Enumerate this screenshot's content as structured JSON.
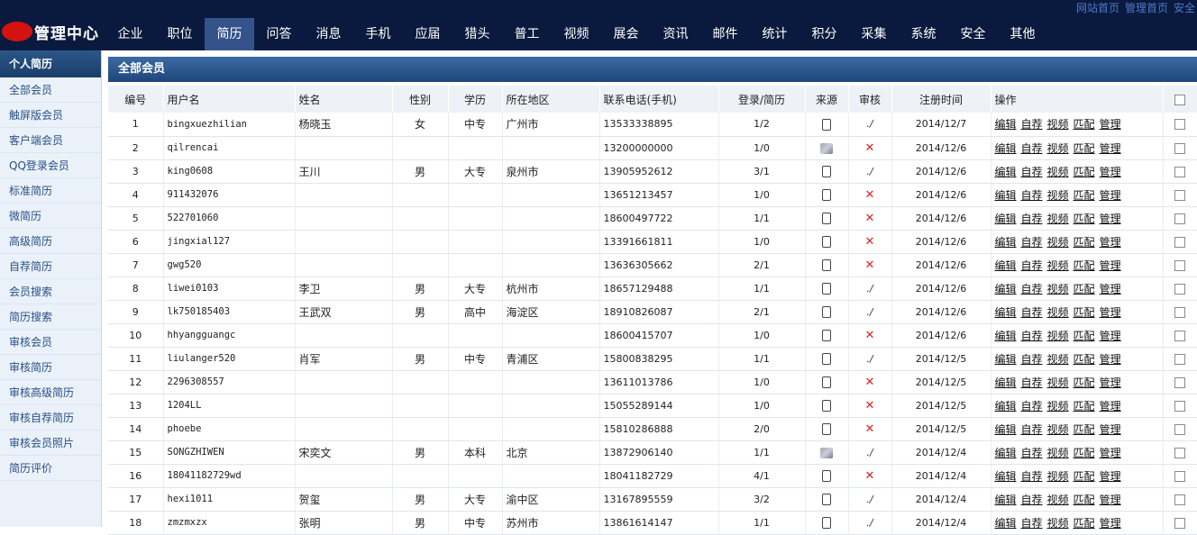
{
  "header": {
    "logo_text": "管理中心",
    "nav": [
      "企业",
      "职位",
      "简历",
      "问答",
      "消息",
      "手机",
      "应届",
      "猎头",
      "普工",
      "视频",
      "展会",
      "资讯",
      "邮件",
      "统计",
      "积分",
      "采集",
      "系统",
      "安全",
      "其他"
    ],
    "active_index": 2,
    "top_links": [
      "网站首页",
      "管理首页",
      "安全"
    ]
  },
  "sidebar": {
    "title": "个人简历",
    "items": [
      "全部会员",
      "触屏版会员",
      "客户端会员",
      "QQ登录会员",
      "标准简历",
      "微简历",
      "高级简历",
      "自荐简历",
      "会员搜索",
      "简历搜索",
      "审核会员",
      "审核简历",
      "审核高级简历",
      "审核自荐简历",
      "审核会员照片",
      "简历评价"
    ]
  },
  "panel": {
    "title": "全部会员",
    "columns": [
      "编号",
      "用户名",
      "姓名",
      "性别",
      "学历",
      "所在地区",
      "联系电话(手机)",
      "登录/简历",
      "来源",
      "审核",
      "注册时间",
      "操作"
    ],
    "operations": [
      "编辑",
      "自荐",
      "视频",
      "匹配",
      "管理"
    ],
    "rows": [
      {
        "id": "1",
        "username": "bingxuezhilian",
        "name": "杨晓玉",
        "gender": "女",
        "edu": "中专",
        "region": "广州市",
        "phone": "13533338895",
        "login": "1/2",
        "source": "tablet",
        "audit": "ok",
        "date": "2014/12/7"
      },
      {
        "id": "2",
        "username": "qilrencai",
        "name": "",
        "gender": "",
        "edu": "",
        "region": "",
        "phone": "13200000000",
        "login": "1/0",
        "source": "pc",
        "audit": "x",
        "date": "2014/12/6"
      },
      {
        "id": "3",
        "username": "king0608",
        "name": "王川",
        "gender": "男",
        "edu": "大专",
        "region": "泉州市",
        "phone": "13905952612",
        "login": "3/1",
        "source": "tablet",
        "audit": "ok",
        "date": "2014/12/6"
      },
      {
        "id": "4",
        "username": "911432076",
        "name": "",
        "gender": "",
        "edu": "",
        "region": "",
        "phone": "13651213457",
        "login": "1/0",
        "source": "tablet",
        "audit": "x",
        "date": "2014/12/6"
      },
      {
        "id": "5",
        "username": "522701060",
        "name": "",
        "gender": "",
        "edu": "",
        "region": "",
        "phone": "18600497722",
        "login": "1/1",
        "source": "tablet",
        "audit": "x",
        "date": "2014/12/6"
      },
      {
        "id": "6",
        "username": "jingxial127",
        "name": "",
        "gender": "",
        "edu": "",
        "region": "",
        "phone": "13391661811",
        "login": "1/0",
        "source": "tablet",
        "audit": "x",
        "date": "2014/12/6"
      },
      {
        "id": "7",
        "username": "gwg520",
        "name": "",
        "gender": "",
        "edu": "",
        "region": "",
        "phone": "13636305662",
        "login": "2/1",
        "source": "tablet",
        "audit": "x",
        "date": "2014/12/6"
      },
      {
        "id": "8",
        "username": "liwei0103",
        "name": "李卫",
        "gender": "男",
        "edu": "大专",
        "region": "杭州市",
        "phone": "18657129488",
        "login": "1/1",
        "source": "tablet",
        "audit": "ok",
        "date": "2014/12/6"
      },
      {
        "id": "9",
        "username": "lk750185403",
        "name": "王武双",
        "gender": "男",
        "edu": "高中",
        "region": "海淀区",
        "phone": "18910826087",
        "login": "2/1",
        "source": "tablet",
        "audit": "ok",
        "date": "2014/12/6"
      },
      {
        "id": "10",
        "username": "hhyangguangc",
        "name": "",
        "gender": "",
        "edu": "",
        "region": "",
        "phone": "18600415707",
        "login": "1/0",
        "source": "tablet",
        "audit": "x",
        "date": "2014/12/6"
      },
      {
        "id": "11",
        "username": "liulanger520",
        "name": "肖军",
        "gender": "男",
        "edu": "中专",
        "region": "青浦区",
        "phone": "15800838295",
        "login": "1/1",
        "source": "tablet",
        "audit": "ok",
        "date": "2014/12/5"
      },
      {
        "id": "12",
        "username": "2296308557",
        "name": "",
        "gender": "",
        "edu": "",
        "region": "",
        "phone": "13611013786",
        "login": "1/0",
        "source": "tablet",
        "audit": "x",
        "date": "2014/12/5"
      },
      {
        "id": "13",
        "username": "1204LL",
        "name": "",
        "gender": "",
        "edu": "",
        "region": "",
        "phone": "15055289144",
        "login": "1/0",
        "source": "tablet",
        "audit": "x",
        "date": "2014/12/5"
      },
      {
        "id": "14",
        "username": "phoebe",
        "name": "",
        "gender": "",
        "edu": "",
        "region": "",
        "phone": "15810286888",
        "login": "2/0",
        "source": "tablet",
        "audit": "x",
        "date": "2014/12/5"
      },
      {
        "id": "15",
        "username": "SONGZHIWEN",
        "name": "宋奕文",
        "gender": "男",
        "edu": "本科",
        "region": "北京",
        "phone": "13872906140",
        "login": "1/1",
        "source": "pc",
        "audit": "ok",
        "date": "2014/12/4"
      },
      {
        "id": "16",
        "username": "18041182729wd",
        "name": "",
        "gender": "",
        "edu": "",
        "region": "",
        "phone": "18041182729",
        "login": "4/1",
        "source": "tablet",
        "audit": "x",
        "date": "2014/12/4"
      },
      {
        "id": "17",
        "username": "hexi1011",
        "name": "贺玺",
        "gender": "男",
        "edu": "大专",
        "region": "渝中区",
        "phone": "13167895559",
        "login": "3/2",
        "source": "tablet",
        "audit": "ok",
        "date": "2014/12/4"
      },
      {
        "id": "18",
        "username": "zmzmxzx",
        "name": "张明",
        "gender": "男",
        "edu": "中专",
        "region": "苏州市",
        "phone": "13861614147",
        "login": "1/1",
        "source": "tablet",
        "audit": "ok",
        "date": "2014/12/4"
      }
    ]
  }
}
